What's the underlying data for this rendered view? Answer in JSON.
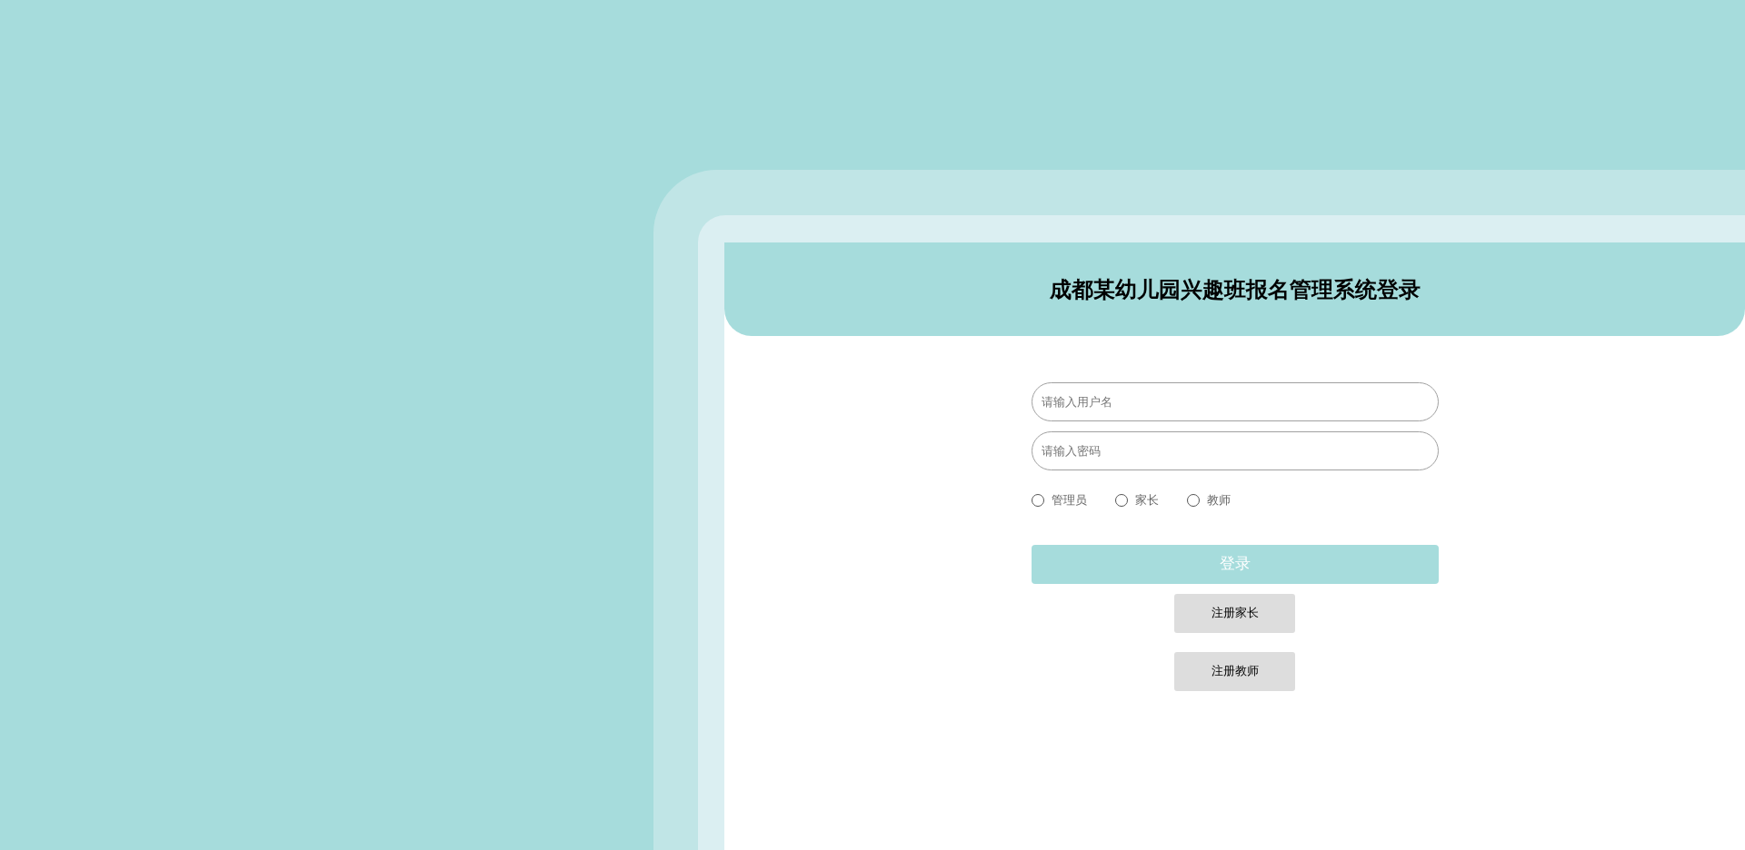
{
  "header": {
    "title": "成都某幼儿园兴趣班报名管理系统登录"
  },
  "fields": [
    {
      "placeholder": "请输入用户名"
    },
    {
      "placeholder": "请输入密码"
    }
  ],
  "roles": [
    {
      "label": "管理员",
      "selected": false
    },
    {
      "label": "家长",
      "selected": false
    },
    {
      "label": "教师",
      "selected": false
    }
  ],
  "login_button": "登录",
  "register_buttons": [
    "注册家长",
    "注册教师"
  ]
}
